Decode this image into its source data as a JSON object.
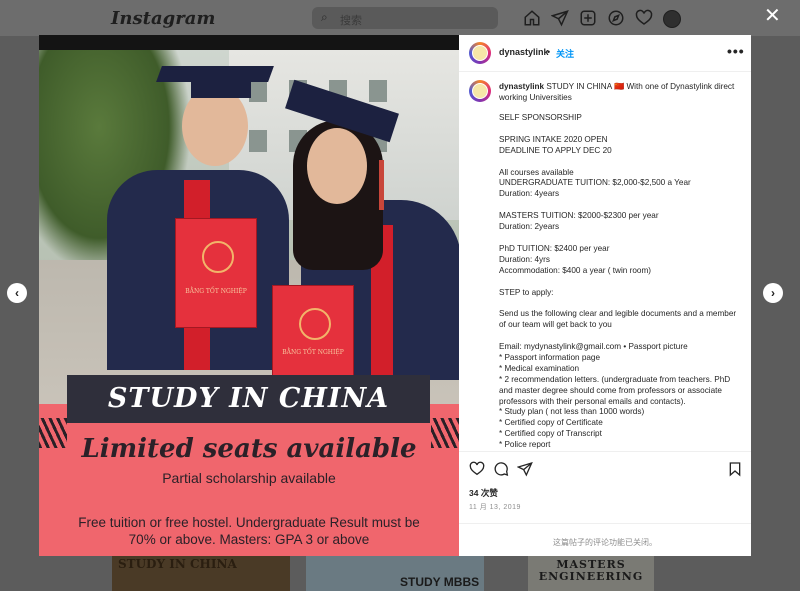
{
  "topbar": {
    "logo": "Instagram",
    "search_placeholder": "搜索",
    "icons": [
      "home-icon",
      "direct-icon",
      "new-post-icon",
      "explore-icon",
      "heart-icon",
      "profile-avatar"
    ]
  },
  "background_tiles": [
    "STUDY IN CHINA",
    "STUDY MBBS",
    "MASTERS ENGINEERING"
  ],
  "post_image": {
    "folder_text": "BẰNG TỐT NGHIỆP",
    "banner_title": "STUDY IN CHINA",
    "headline": "Limited seats available",
    "subline": "Partial scholarship available",
    "details": "Free tuition or free hostel. Undergraduate Result must be 70% or above. Masters: GPA 3 or above"
  },
  "post": {
    "username": "dynastylink",
    "separator": "•",
    "follow_label": "关注",
    "more_label": "•••",
    "caption_head": "STUDY IN CHINA 🇨🇳 With one of Dynastylink direct working Universities",
    "caption_body": "SELF SPONSORSHIP\n\nSPRING INTAKE 2020 OPEN\nDEADLINE TO APPLY DEC 20\n\nAll courses available\nUNDERGRADUATE TUITION: $2,000-$2,500 a Year\nDuration: 4years\n\nMASTERS TUITION: $2000-$2300 per year\nDuration: 2years\n\nPhD TUITION: $2400 per year\nDuration: 4yrs\nAccommodation: $400 a year ( twin room)\n\nSTEP to apply:\n\nSend us the following clear and legible documents and a member of our team will get back to you\n\nEmail: mydynastylink@gmail.com • Passport picture\n* Passport information page\n* Medical examination\n* 2 recommendation letters. (undergraduate from teachers. PhD and master degree should come from professors or associate professors with their personal emails and contacts).\n* Study plan ( not less than 1000 words)\n* Certified copy of Certificate\n* Certified copy of Transcript\n* Police report",
    "likes": "34 次赞",
    "date": "11 月 13, 2019",
    "comments_disabled": "这篇帖子的评论功能已关闭。"
  },
  "navigation": {
    "prev": "‹",
    "next": "›",
    "close": "✕"
  },
  "colors": {
    "follow_blue": "#0095f6",
    "banner_red": "#f0666d",
    "gown_navy": "#232a4c"
  }
}
